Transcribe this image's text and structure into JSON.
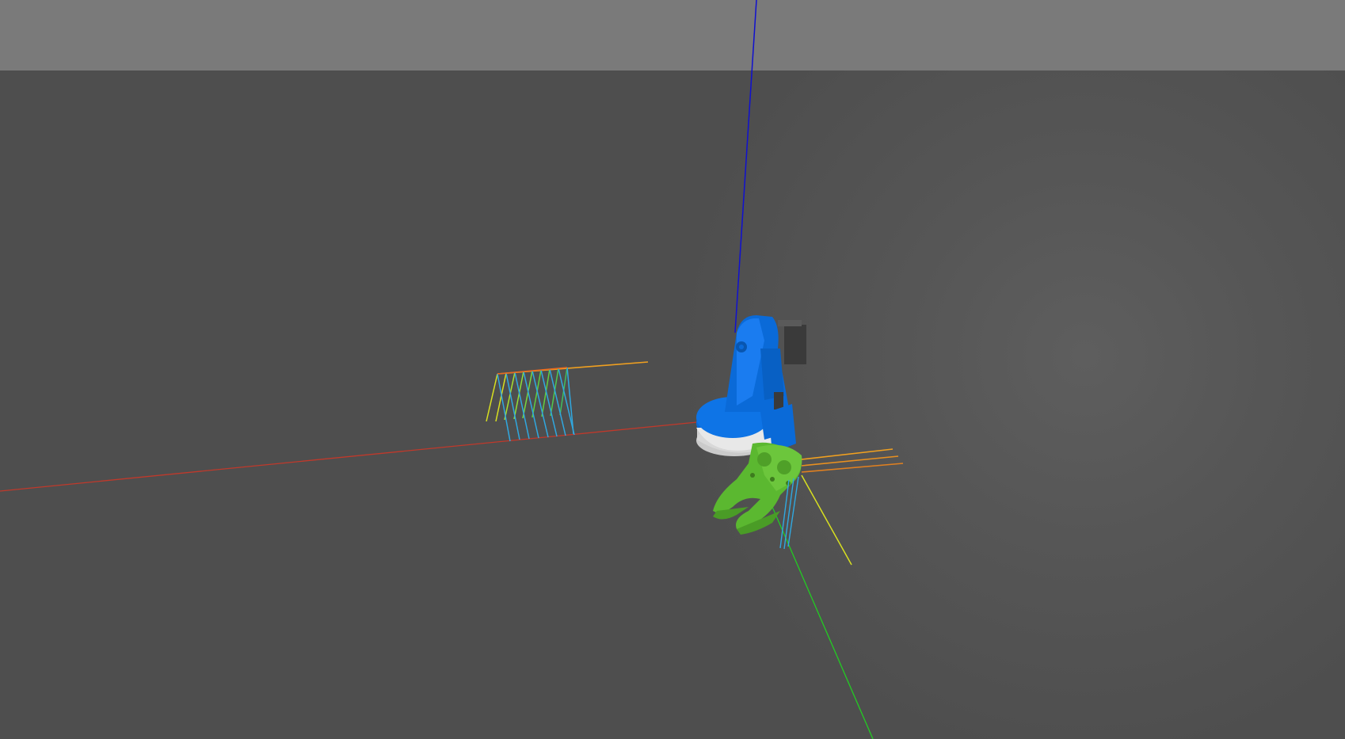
{
  "scene": {
    "sky_color": "#7a7a7a",
    "ground_color": "#4e4e4e",
    "axes": {
      "x_axis_color": "#c0392b",
      "y_axis_color": "#22cc22",
      "z_axis_color": "#1010d0"
    },
    "robot": {
      "arm_color": "#0a6ad8",
      "gripper_color": "#5bb830",
      "base_color": "#e8e8e8",
      "motor_color": "#3a3a3a"
    },
    "trajectory_colors": {
      "warm": "#f0a020",
      "yellow": "#d8e020",
      "green": "#60d040",
      "cyan": "#30a8e0"
    }
  }
}
